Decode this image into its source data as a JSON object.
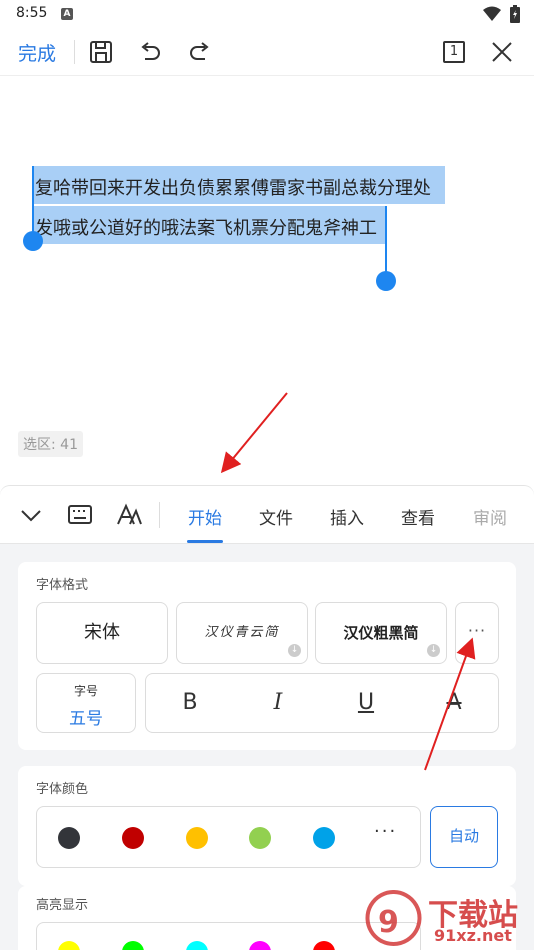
{
  "status_bar": {
    "time": "8:55",
    "app_badge": "A",
    "icons": [
      "wifi-icon",
      "battery-icon"
    ]
  },
  "toolbar": {
    "done_label": "完成",
    "icons": [
      "save-icon",
      "undo-icon",
      "redo-icon",
      "page-count-icon",
      "close-icon"
    ],
    "page_count": "1"
  },
  "document": {
    "line1": "复哈带回来开发出负债累累傅雷家书副总裁分理处",
    "line2": "发哦或公道好的哦法案飞机票分配鬼斧神工",
    "selection_count": "选区: 41"
  },
  "tabs": {
    "icons": [
      "collapse-chevron-icon",
      "keyboard-icon",
      "font-style-icon"
    ],
    "items": [
      "开始",
      "文件",
      "插入",
      "查看",
      "审阅"
    ],
    "active": "开始"
  },
  "font_format": {
    "title": "字体格式",
    "fonts": [
      "宋体",
      "汉仪青云简",
      "汉仪粗黑简"
    ],
    "more_label": "···",
    "size_label": "字号",
    "size_value": "五号",
    "buttons": [
      "B",
      "I",
      "U",
      "A"
    ]
  },
  "font_color": {
    "title": "字体颜色",
    "colors": [
      "#33353a",
      "#c00000",
      "#ffc000",
      "#92d050",
      "#00a2e8"
    ],
    "more_label": "···",
    "auto_label": "自动"
  },
  "highlight": {
    "title": "高亮显示",
    "colors": [
      "#ffff00",
      "#00ff00",
      "#00ffff",
      "#ff00ff",
      "#ff0000"
    ]
  },
  "watermark": {
    "text": "下载站",
    "url_text": "91xz.net"
  },
  "accent_color": "#2a7ae2",
  "annotation_color": "#e02020"
}
